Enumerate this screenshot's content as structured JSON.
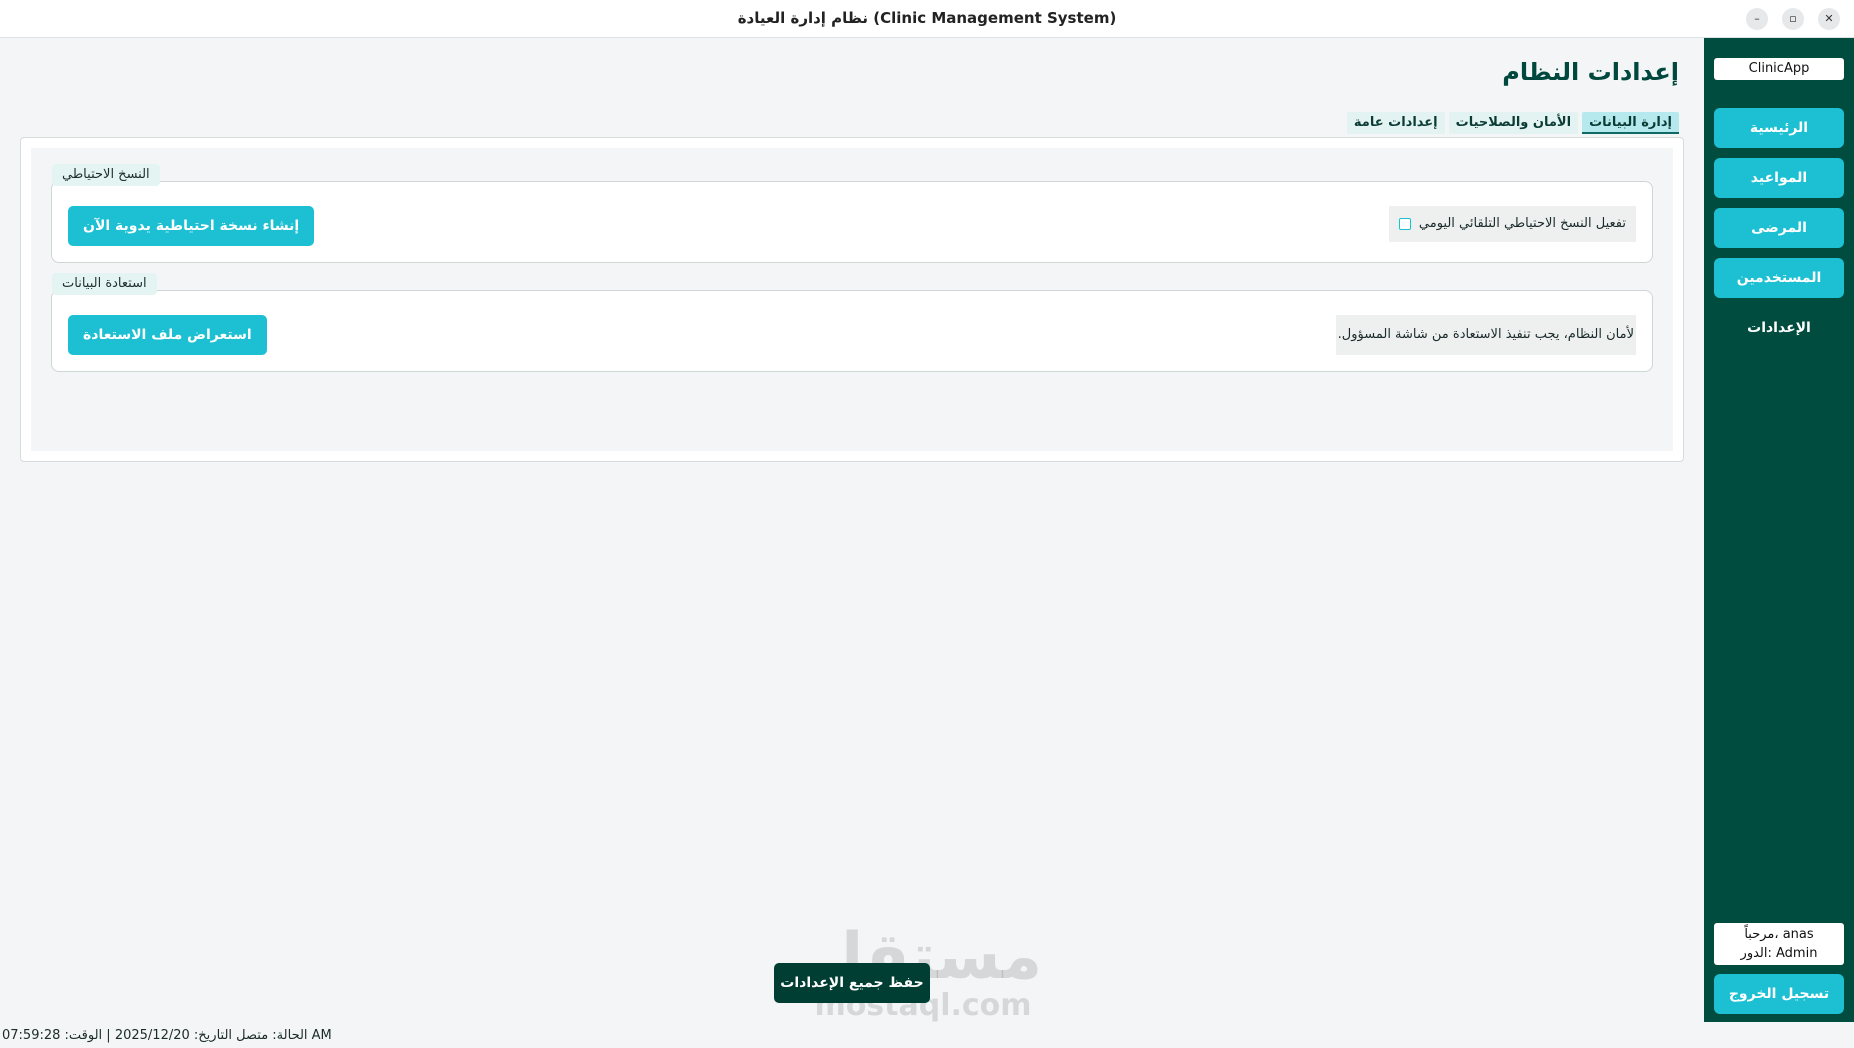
{
  "window": {
    "title": "نظام إدارة العيادة (Clinic Management System)",
    "minimize_glyph": "–",
    "maximize_glyph": "▫",
    "close_glyph": "✕"
  },
  "sidebar": {
    "brand": "ClinicApp",
    "items": [
      {
        "label": "الرئيسية"
      },
      {
        "label": "المواعيد"
      },
      {
        "label": "المرضى"
      },
      {
        "label": "المستخدمين"
      },
      {
        "label": "الإعدادات",
        "active": true
      }
    ],
    "welcome_line": "مرحباً، anas",
    "role_line": "الدور: Admin",
    "logout_label": "تسجيل الخروج"
  },
  "main": {
    "title": "إعدادات النظام",
    "tabs": [
      {
        "label": "إعدادات عامة"
      },
      {
        "label": "الأمان والصلاحيات"
      },
      {
        "label": "إدارة البيانات",
        "active": true
      }
    ],
    "backup": {
      "group_title": "النسخ الاحتياطي",
      "auto_backup_label": "تفعيل النسخ الاحتياطي التلقائي اليومي",
      "auto_backup_checked": false,
      "manual_backup_button": "إنشاء نسخة احتياطية يدوية الآن"
    },
    "restore": {
      "group_title": "استعادة البيانات",
      "note": "لأمان النظام، يجب تنفيذ الاستعادة من شاشة المسؤول.",
      "browse_button": "استعراض ملف الاستعادة"
    },
    "save_all_button": "حفظ جميع الإعدادات"
  },
  "watermark": {
    "arabic": "مستقل",
    "latin": "mostaql.com"
  },
  "status_bar": {
    "text": "الحالة: متصل التاريخ: 2025/12/20 | الوقت: 07:59:28 AM"
  },
  "colors": {
    "sidebar_bg": "#004d40",
    "accent": "#1cc0d2",
    "save_button": "#003d33",
    "title_color": "#00473d"
  }
}
